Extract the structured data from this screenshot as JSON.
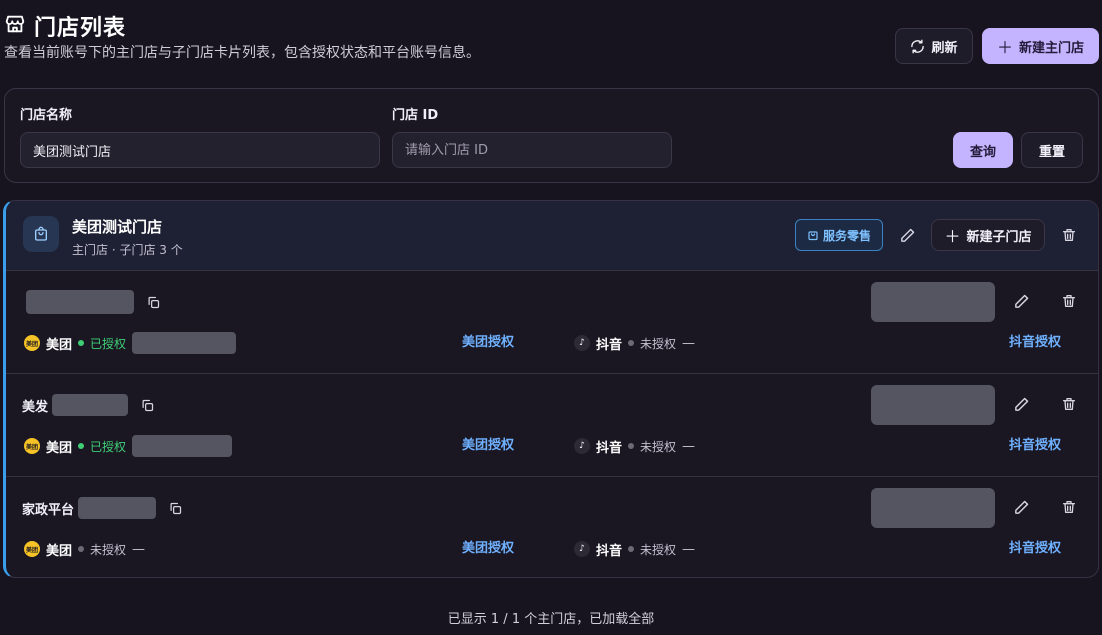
{
  "page": {
    "title": "门店列表",
    "subtitle": "查看当前账号下的主门店与子门店卡片列表，包含授权状态和平台账号信息。",
    "refresh_label": "刷新",
    "new_main_label": "新建主门店"
  },
  "filter": {
    "name_label": "门店名称",
    "name_value": "美团测试门店",
    "id_label": "门店 ID",
    "id_placeholder": "请输入门店 ID",
    "query_label": "查询",
    "reset_label": "重置"
  },
  "store": {
    "name": "美团测试门店",
    "meta": "主门店 · 子门店 3 个",
    "tag": "服务零售",
    "new_sub_label": "新建子门店",
    "subs": [
      {
        "name": "",
        "meituan": {
          "name": "美团",
          "status": "已授权",
          "authorized": true,
          "auth_link": "美团授权"
        },
        "douyin": {
          "name": "抖音",
          "status": "未授权",
          "dash": "—",
          "auth_link": "抖音授权"
        }
      },
      {
        "name": "美发",
        "meituan": {
          "name": "美团",
          "status": "已授权",
          "authorized": true,
          "auth_link": "美团授权"
        },
        "douyin": {
          "name": "抖音",
          "status": "未授权",
          "dash": "—",
          "auth_link": "抖音授权"
        }
      },
      {
        "name": "家政平台",
        "meituan": {
          "name": "美团",
          "status": "未授权",
          "authorized": false,
          "dash": "—",
          "auth_link": "美团授权"
        },
        "douyin": {
          "name": "抖音",
          "status": "未授权",
          "dash": "—",
          "auth_link": "抖音授权"
        }
      }
    ]
  },
  "logos": {
    "meituan_text": "美团",
    "douyin_glyph": "♪"
  },
  "footer": {
    "text": "已显示 1 / 1 个主门店，已加载全部"
  },
  "colors": {
    "accent": "#c4b4ff",
    "link": "#6fb0ff",
    "authorized": "#3ecf75",
    "card_border_accent": "#3b9eea"
  }
}
